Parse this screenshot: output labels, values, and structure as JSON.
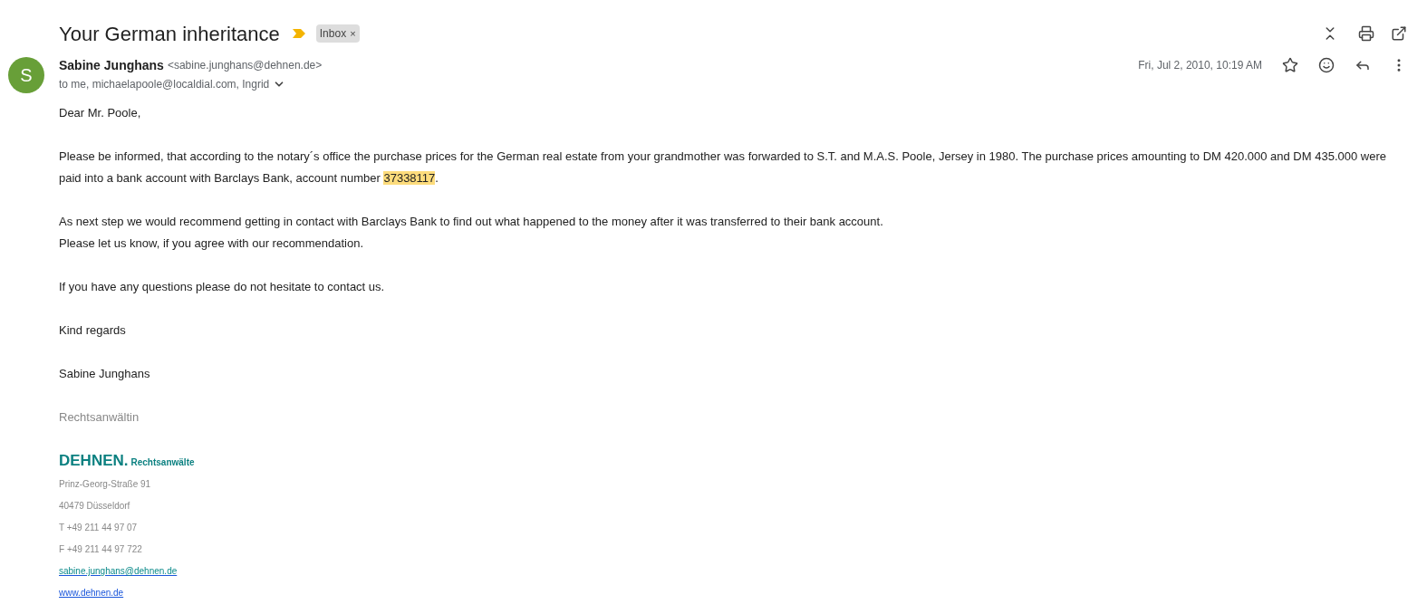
{
  "subject": "Your German inheritance",
  "important": true,
  "labels": [
    {
      "text": "Inbox",
      "close": "×"
    }
  ],
  "sender": {
    "initial": "S",
    "name": "Sabine Junghans",
    "email": "<sabine.junghans@dehnen.de>",
    "recipients": "to me, michaelapoole@localdial.com, Ingrid",
    "date": "Fri, Jul 2, 2010, 10:19 AM",
    "starred": false
  },
  "body": [
    {
      "lines": [
        {
          "text": "Dear Mr. Poole,"
        }
      ]
    },
    {
      "lines": [
        {
          "text": "Please be informed, that according to the notary´s office the purchase prices for the German real estate from your grandmother was forwarded to S.T. and M.A.S. Poole, Jersey in 1980. The purchase prices amounting to DM 420.000 and DM 435.000 were paid into a bank account with Barclays Bank, account number ",
          "highlight": "37338117",
          "after": "."
        }
      ]
    },
    {
      "lines": [
        {
          "text": "As next step we would recommend getting in contact with Barclays Bank to find out what happened to the money after it was transferred to their bank account."
        },
        {
          "text": "Please let us know, if you agree with our recommendation."
        }
      ]
    },
    {
      "lines": [
        {
          "text": "If you have any questions please do not hesitate to contact us."
        }
      ]
    },
    {
      "lines": [
        {
          "text": "Kind regards"
        }
      ]
    },
    {
      "lines": [
        {
          "text": "Sabine Junghans"
        }
      ]
    }
  ],
  "signature": {
    "role": "Rechtsanwältin",
    "brand": "DEHNEN.",
    "brand_sub": "Rechtsanwälte",
    "lines": [
      {
        "kind": "text",
        "text": "Prinz-Georg-Straße 91"
      },
      {
        "kind": "text",
        "text": "40479 Düsseldorf"
      },
      {
        "kind": "text",
        "text": "T +49 211 44 97 07"
      },
      {
        "kind": "text",
        "text": "F +49 211 44 97 722"
      },
      {
        "kind": "email",
        "text": "sabine.junghans@dehnen.de"
      },
      {
        "kind": "web",
        "text": "www.dehnen.de"
      }
    ]
  }
}
